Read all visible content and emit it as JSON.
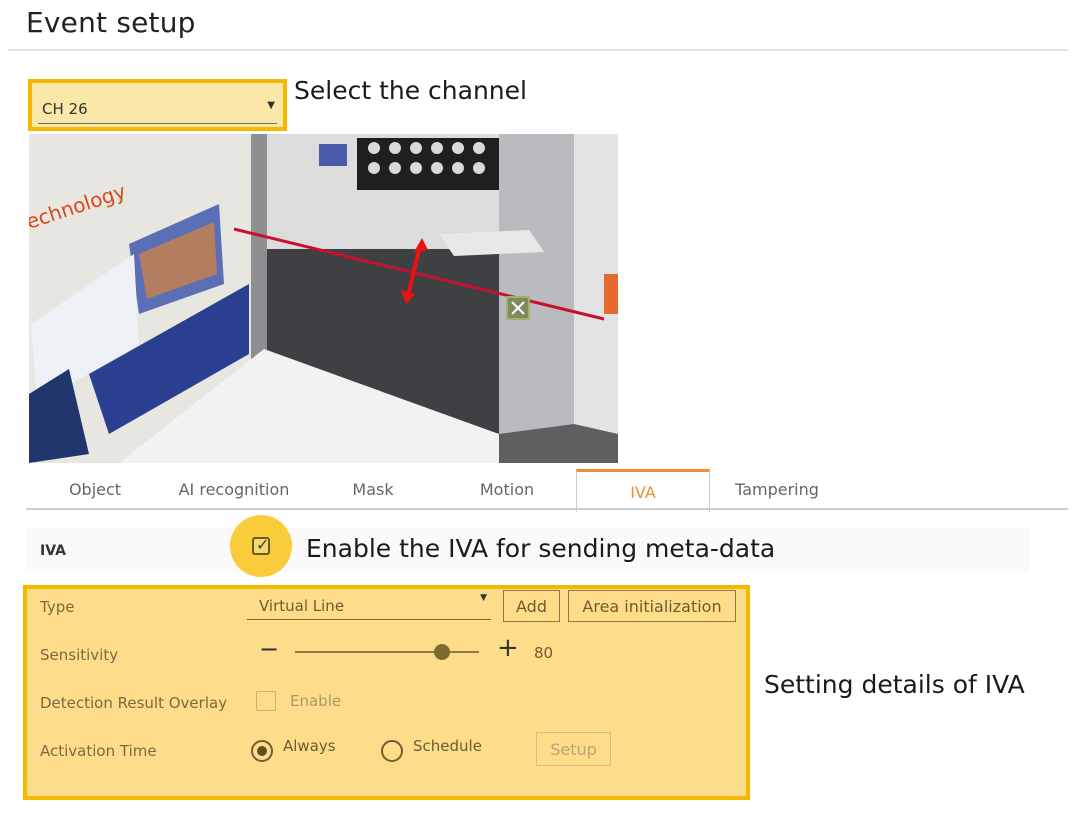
{
  "title": "Event setup",
  "channel": {
    "value": "CH 26",
    "note": "Select the channel"
  },
  "tabs": [
    {
      "label": "Object"
    },
    {
      "label": "AI recognition"
    },
    {
      "label": "Mask"
    },
    {
      "label": "Motion"
    },
    {
      "label": "IVA",
      "active": true
    },
    {
      "label": "Tampering"
    }
  ],
  "iva": {
    "label": "IVA",
    "enabled": true,
    "note": "Enable the IVA for sending meta-data"
  },
  "details": {
    "type_label": "Type",
    "type_value": "Virtual Line",
    "add_label": "Add",
    "area_init_label": "Area initialization",
    "sensitivity_label": "Sensitivity",
    "sensitivity_value": "80",
    "sensitivity_min_symbol": "−",
    "sensitivity_max_symbol": "+",
    "overlay_label": "Detection Result Overlay",
    "overlay_enable_label": "Enable",
    "overlay_checked": false,
    "activation_label": "Activation Time",
    "always_label": "Always",
    "schedule_label": "Schedule",
    "activation_selected": "Always",
    "setup_label": "Setup",
    "note": "Setting details of IVA"
  },
  "colors": {
    "highlight_border": "#f5b800",
    "highlight_fill": "#fddd8a",
    "tab_active": "#f08c3a",
    "virtual_line": "#c8102e"
  },
  "icons": [
    "dropdown-caret-icon",
    "checkbox-check-icon",
    "close-icon",
    "direction-arrow-icon"
  ]
}
